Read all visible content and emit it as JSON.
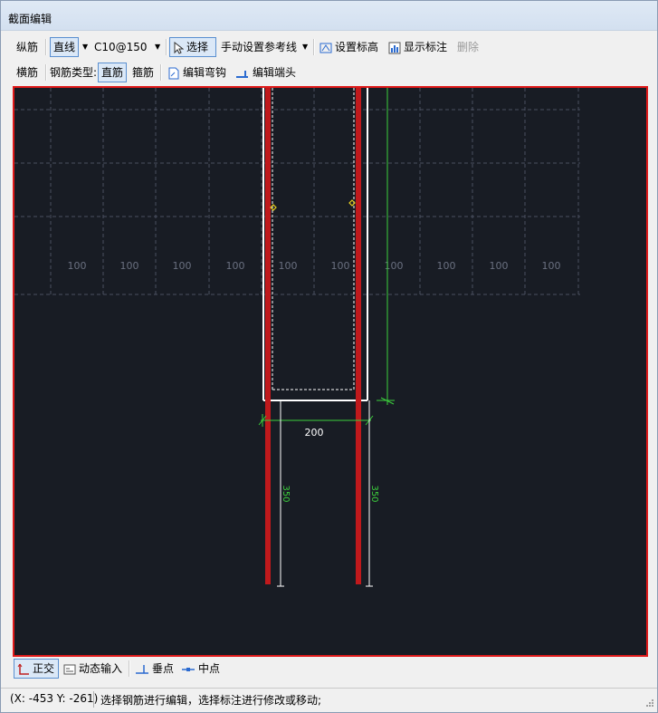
{
  "window": {
    "title": "截面编辑"
  },
  "toolbar1": {
    "longitudinal_label": "纵筋",
    "line_mode_label": "直线",
    "rebar_spec": "C10@150",
    "select_label": "选择",
    "guide_line_label": "手动设置参考线",
    "set_elevation_label": "设置标高",
    "show_dimension_label": "显示标注",
    "delete_label": "删除"
  },
  "toolbar2": {
    "transverse_label": "横筋",
    "rebar_type_label": "钢筋类型:",
    "straight_label": "直筋",
    "stirrup_label": "箍筋",
    "edit_hook_label": "编辑弯钩",
    "edit_end_label": "编辑端头"
  },
  "canvas": {
    "grid_labels": [
      "100",
      "100",
      "100",
      "100",
      "100",
      "100",
      "100",
      "100",
      "100",
      "100"
    ],
    "dim_width": "200",
    "dim_left_length": "350",
    "dim_right_length": "350",
    "colors": {
      "background": "#181c24",
      "rebar": "#c0191c",
      "dimension": "#3ccf3c",
      "outline": "#ffffff",
      "border": "#e01a1a",
      "marker": "#e8d020"
    }
  },
  "bottombar": {
    "ortho_label": "正交",
    "dynamic_input_label": "动态输入",
    "perpendicular_label": "垂点",
    "midpoint_label": "中点"
  },
  "status": {
    "coords": "(X: -453 Y: -261)",
    "message": "选择钢筋进行编辑，选择标注进行修改或移动;"
  }
}
